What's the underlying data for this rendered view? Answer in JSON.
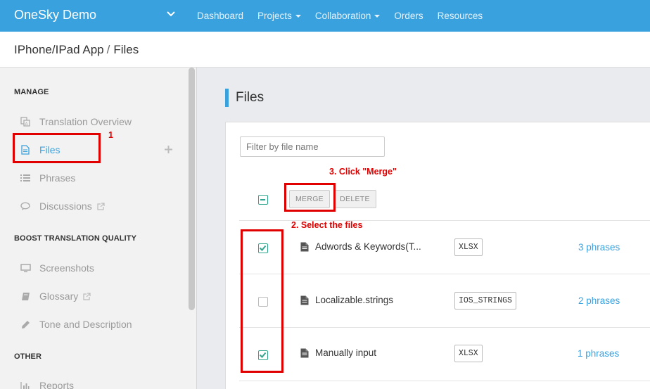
{
  "topbar": {
    "brand": "OneSky Demo",
    "nav": [
      {
        "label": "Dashboard",
        "dropdown": false
      },
      {
        "label": "Projects",
        "dropdown": true
      },
      {
        "label": "Collaboration",
        "dropdown": true
      },
      {
        "label": "Orders",
        "dropdown": false
      },
      {
        "label": "Resources",
        "dropdown": false
      }
    ]
  },
  "breadcrumb": {
    "project": "IPhone/IPad App",
    "separator": "/",
    "page": "Files"
  },
  "sidebar": {
    "sections": [
      {
        "title": "MANAGE",
        "items": [
          {
            "label": "Translation Overview",
            "icon": "translate-icon"
          },
          {
            "label": "Files",
            "icon": "file-icon",
            "active": true
          },
          {
            "label": "Phrases",
            "icon": "list-icon"
          },
          {
            "label": "Discussions",
            "icon": "chat-icon",
            "external": true
          }
        ]
      },
      {
        "title": "BOOST TRANSLATION QUALITY",
        "items": [
          {
            "label": "Screenshots",
            "icon": "monitor-icon"
          },
          {
            "label": "Glossary",
            "icon": "book-icon",
            "external": true
          },
          {
            "label": "Tone and Description",
            "icon": "pencil-icon"
          }
        ]
      },
      {
        "title": "OTHER",
        "items": [
          {
            "label": "Reports",
            "icon": "bar-chart-icon"
          }
        ]
      }
    ]
  },
  "main": {
    "title": "Files",
    "filter_placeholder": "Filter by file name",
    "merge_label": "MERGE",
    "delete_label": "DELETE",
    "files": [
      {
        "name": "Adwords & Keywords(T...",
        "type": "XLSX",
        "phrases": "3 phrases",
        "checked": true
      },
      {
        "name": "Localizable.strings",
        "type": "IOS_STRINGS",
        "phrases": "2 phrases",
        "checked": false
      },
      {
        "name": "Manually input",
        "type": "XLSX",
        "phrases": "1 phrases",
        "checked": true
      }
    ]
  },
  "annotations": {
    "step1": "1",
    "step2": "2. Select the files",
    "step3": "3. Click \"Merge\""
  },
  "colors": {
    "accent": "#3aa1df",
    "check": "#2fa58e",
    "annotation": "#e00000"
  }
}
